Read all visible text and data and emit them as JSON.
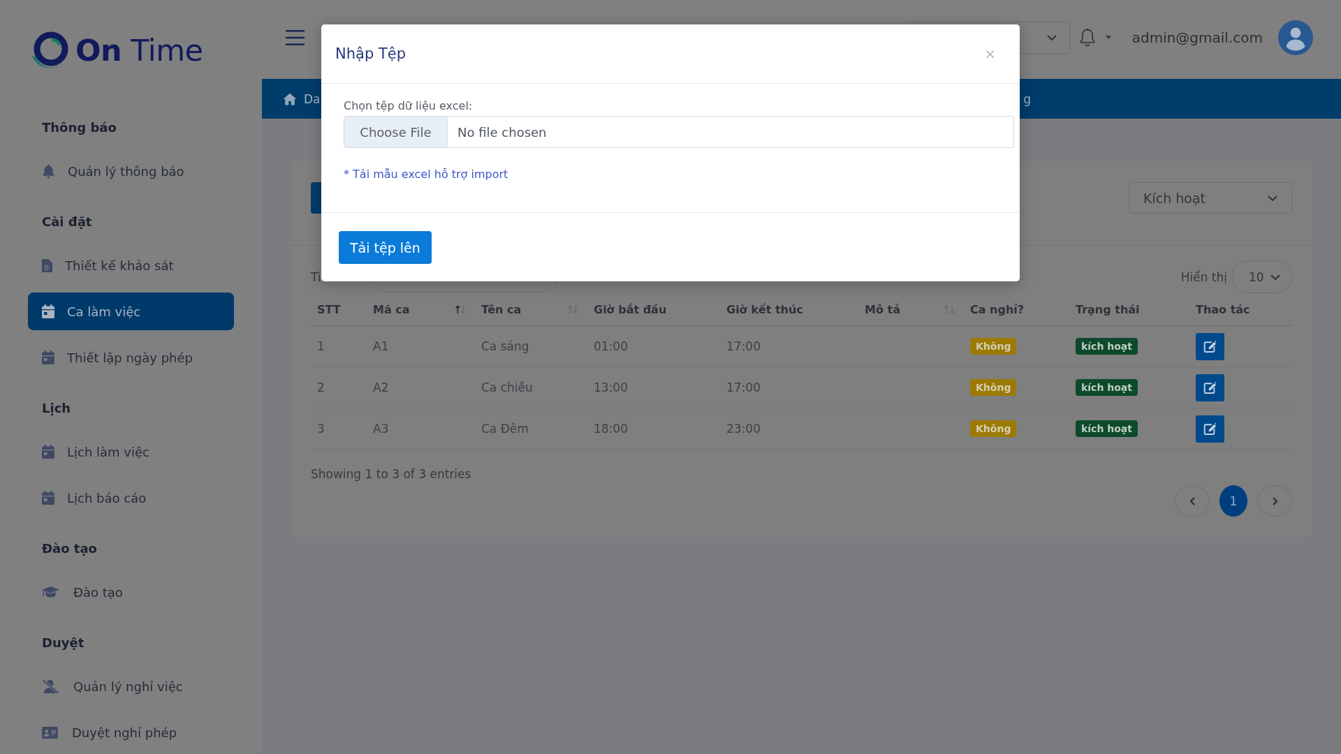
{
  "sidebar": {
    "logo": "**On** Time",
    "sections": [
      {
        "title": "Thông báo",
        "items": [
          {
            "label": "Quản lý thông báo",
            "selected": false
          }
        ]
      },
      {
        "title": "Cài đặt",
        "items": [
          {
            "label": "Thiết kế khảo sát",
            "selected": false
          },
          {
            "label": "Ca làm việc",
            "selected": true
          },
          {
            "label": "Thiết lập ngày phép",
            "selected": false
          }
        ]
      },
      {
        "title": "Lịch",
        "items": [
          {
            "label": "Lịch làm việc",
            "selected": false
          },
          {
            "label": "Lịch báo cáo",
            "selected": false
          }
        ]
      },
      {
        "title": "Đào tạo",
        "items": [
          {
            "label": "Đào tạo",
            "selected": false
          }
        ]
      },
      {
        "title": "Duyệt",
        "items": [
          {
            "label": "Quản lý nghỉ việc",
            "selected": false
          },
          {
            "label": "Duyệt nghỉ phép",
            "selected": false
          }
        ]
      }
    ]
  },
  "topbar": {
    "user_email": "admin@gmail.com"
  },
  "breadcrumb": {
    "visible_start": "Da",
    "visible_end": "g"
  },
  "card": {
    "status_filter": "Kích hoạt",
    "search_label": "Ti",
    "page_size_label": "Hiển thị",
    "page_size": "10",
    "table": {
      "columns": [
        {
          "label": "STT",
          "sortable": false
        },
        {
          "label": "Mã ca",
          "sortable": true,
          "sorted": true
        },
        {
          "label": "Tên ca",
          "sortable": true,
          "sorted": false
        },
        {
          "label": "Giờ bắt đầu",
          "sortable": false
        },
        {
          "label": "Giờ kết thúc",
          "sortable": false
        },
        {
          "label": "Mô tả",
          "sortable": true,
          "sorted": false
        },
        {
          "label": "Ca nghỉ?",
          "sortable": false
        },
        {
          "label": "Trạng thái",
          "sortable": false
        },
        {
          "label": "Thao tác",
          "sortable": false
        }
      ],
      "rows": [
        {
          "stt": "1",
          "code": "A1",
          "name": "Ca sáng",
          "start": "01:00",
          "end": "17:00",
          "day_off": "Không",
          "status": "kích hoạt"
        },
        {
          "stt": "2",
          "code": "A2",
          "name": "Ca chiều",
          "start": "13:00",
          "end": "17:00",
          "day_off": "Không",
          "status": "kích hoạt"
        },
        {
          "stt": "3",
          "code": "A3",
          "name": "Ca Đêm",
          "start": "18:00",
          "end": "23:00",
          "day_off": "Không",
          "status": "kích hoạt"
        }
      ]
    },
    "summary": "Showing 1 to 3 of 3 entries",
    "pagination": {
      "pages": [
        {
          "label": "1",
          "selected": true
        }
      ]
    }
  },
  "modal": {
    "title": "Nhập Tệp",
    "close": "×",
    "file_label": "Chọn tệp dữ liệu excel:",
    "file_button": "Choose File",
    "file_status": "No file chosen",
    "template_link": "* Tải mẫu excel hỗ trợ import",
    "submit": "Tải tệp lên"
  }
}
